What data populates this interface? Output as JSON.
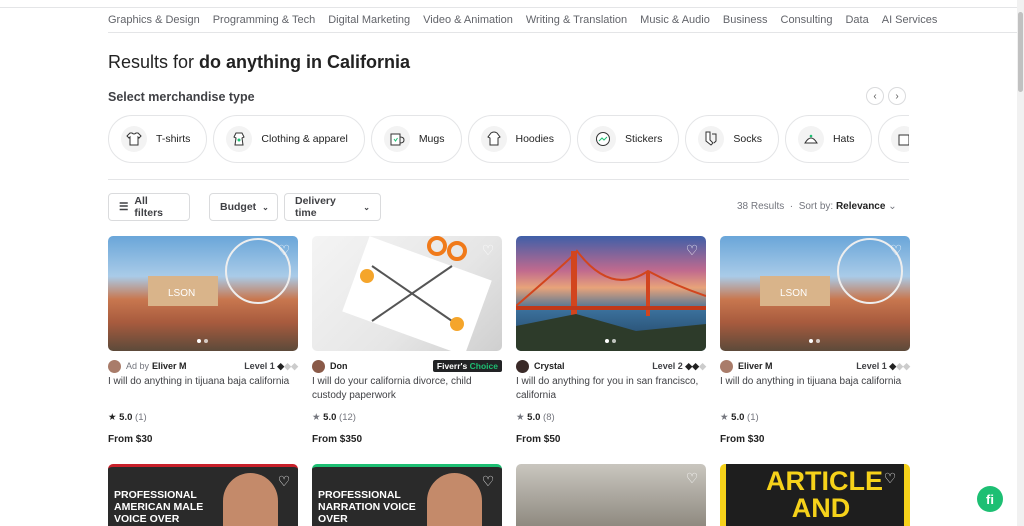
{
  "categories": [
    "Graphics & Design",
    "Programming & Tech",
    "Digital Marketing",
    "Video & Animation",
    "Writing & Translation",
    "Music & Audio",
    "Business",
    "Consulting",
    "Data",
    "AI Services"
  ],
  "results_prefix": "Results for ",
  "query": "do anything in California",
  "merch_title": "Select merchandise type",
  "merch_chips": [
    "T-shirts",
    "Clothing & apparel",
    "Mugs",
    "Hoodies",
    "Stickers",
    "Socks",
    "Hats"
  ],
  "filters": {
    "all": "All filters",
    "budget": "Budget",
    "delivery": "Delivery time"
  },
  "results_count": "38 Results",
  "sort_label": "Sort by:",
  "sort_value": "Relevance",
  "gigs": [
    {
      "ad": "Ad by",
      "seller": "Eliver M",
      "level": "Level 1",
      "title": "I will do anything in tijuana baja california",
      "rating": "5.0",
      "reviews": "(1)",
      "price": "From $30"
    },
    {
      "seller": "Don",
      "badge_a": "Fiverr's",
      "badge_b": "Choice",
      "title": "I will do your california divorce, child custody paperwork",
      "rating": "5.0",
      "reviews": "(12)",
      "price": "From $350"
    },
    {
      "seller": "Crystal",
      "level": "Level 2",
      "title": "I will do anything for you in san francisco, california",
      "rating": "5.0",
      "reviews": "(8)",
      "price": "From $50"
    },
    {
      "seller": "Eliver M",
      "level": "Level 1",
      "title": "I will do anything in tijuana baja california",
      "rating": "5.0",
      "reviews": "(1)",
      "price": "From $30"
    }
  ],
  "bottom_cards": [
    {
      "text": "PROFESSIONAL AMERICAN MALE VOICE OVER"
    },
    {
      "text": "PROFESSIONAL NARRATION VOICE OVER"
    },
    {
      "text": ""
    },
    {
      "text": "ARTICLE AND"
    }
  ],
  "fab": "fi",
  "colors": {
    "accent": "#1dbf73",
    "text": "#222222",
    "muted": "#74767e"
  }
}
